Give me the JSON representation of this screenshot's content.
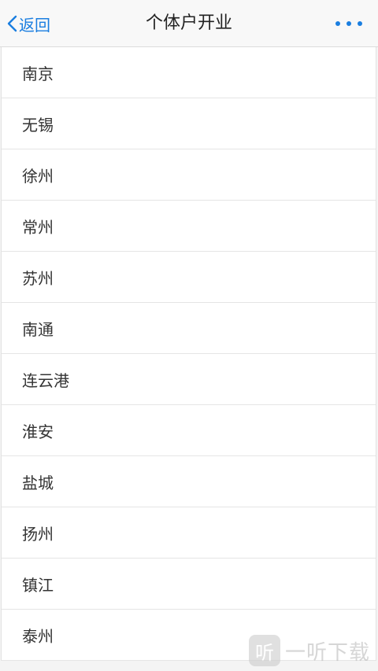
{
  "navbar": {
    "back_label": "返回",
    "title": "个体户开业",
    "accent_color": "#1a7ee0"
  },
  "cities": [
    {
      "label": "南京"
    },
    {
      "label": "无锡"
    },
    {
      "label": "徐州"
    },
    {
      "label": "常州"
    },
    {
      "label": "苏州"
    },
    {
      "label": "南通"
    },
    {
      "label": "连云港"
    },
    {
      "label": "淮安"
    },
    {
      "label": "盐城"
    },
    {
      "label": "扬州"
    },
    {
      "label": "镇江"
    },
    {
      "label": "泰州"
    }
  ],
  "watermark": {
    "badge": "听",
    "text": "一听下载"
  }
}
